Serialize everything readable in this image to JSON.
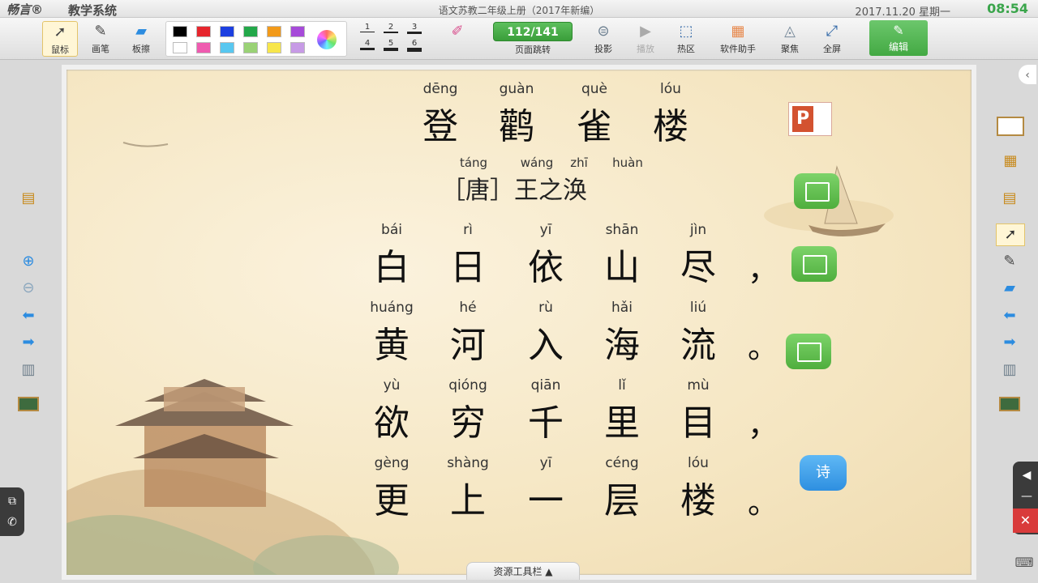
{
  "titlebar": {
    "logo": "畅言®",
    "app_name": "教学系统",
    "document_title": "语文苏教二年级上册（2017年新编）",
    "date": "2017.11.20  星期一",
    "time": "08:54"
  },
  "toolbar": {
    "mouse": "鼠标",
    "pen": "画笔",
    "eraser": "板擦",
    "colors": [
      "#000000",
      "#e6262d",
      "#1c3fe0",
      "#23a84a",
      "#f29a1a",
      "#a64bd9",
      "#ffffff",
      "#ef5bb0",
      "#58c7f0",
      "#9ad276",
      "#f7e64b",
      "#c79be6"
    ],
    "line_widths": [
      "1",
      "2",
      "3",
      "4",
      "5",
      "6"
    ],
    "page_indicator": "112/141",
    "page_jump": "页面跳转",
    "projection": "投影",
    "play": "播放",
    "hotspot": "热区",
    "software_helper": "软件助手",
    "focus": "聚焦",
    "fullscreen": "全屏",
    "edit": "编辑"
  },
  "poem": {
    "title_pinyin": [
      "dēng",
      "guàn",
      "què",
      "lóu"
    ],
    "title_chars": [
      "登",
      "鹳",
      "雀",
      "楼"
    ],
    "author_pinyin": [
      "táng",
      "wáng",
      "zhī",
      "huàn"
    ],
    "author": "［唐］王之涣",
    "lines": [
      {
        "pinyin": [
          "bái",
          "rì",
          "yī",
          "shān",
          "jìn"
        ],
        "chars": [
          "白",
          "日",
          "依",
          "山",
          "尽"
        ],
        "punct": "，"
      },
      {
        "pinyin": [
          "huáng",
          "hé",
          "rù",
          "hǎi",
          "liú"
        ],
        "chars": [
          "黄",
          "河",
          "入",
          "海",
          "流"
        ],
        "punct": "。"
      },
      {
        "pinyin": [
          "yù",
          "qióng",
          "qiān",
          "lǐ",
          "mù"
        ],
        "chars": [
          "欲",
          "穷",
          "千",
          "里",
          "目"
        ],
        "punct": "，"
      },
      {
        "pinyin": [
          "gèng",
          "shàng",
          "yī",
          "céng",
          "lóu"
        ],
        "chars": [
          "更",
          "上",
          "一",
          "层",
          "楼"
        ],
        "punct": "。"
      }
    ]
  },
  "resources": {
    "ppt_label": "P",
    "poem_button": "诗",
    "toolbar_tab": "资源工具栏 ▲"
  },
  "right_controls": {
    "close": "✕",
    "minimize": "—"
  }
}
